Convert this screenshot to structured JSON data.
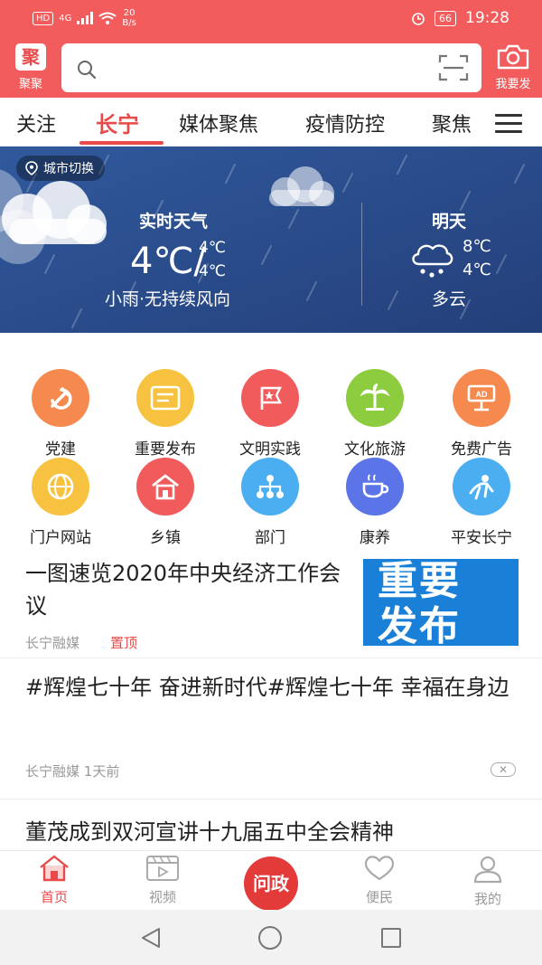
{
  "status_bar": {
    "hd": "HD",
    "network": "4G",
    "speed_value": "20",
    "speed_unit": "B/s",
    "battery": "66",
    "time": "19:28"
  },
  "header": {
    "logo_label": "聚聚",
    "search_placeholder": "",
    "camera_label": "我要发"
  },
  "tabs": [
    {
      "label": "关注"
    },
    {
      "label": "长宁"
    },
    {
      "label": "媒体聚焦"
    },
    {
      "label": "疫情防控"
    },
    {
      "label": "聚焦"
    }
  ],
  "weather": {
    "city_switch": "城市切换",
    "now_title": "实时天气",
    "now_temp": "4℃/",
    "now_high": "4℃",
    "now_low": "4℃",
    "now_desc": "小雨·无持续风向",
    "tomorrow_title": "明天",
    "tomorrow_high": "8℃",
    "tomorrow_low": "4℃",
    "tomorrow_desc": "多云"
  },
  "shortcuts": [
    {
      "label": "党建",
      "color": "#f5894e",
      "icon": "party-emblem-icon"
    },
    {
      "label": "重要发布",
      "color": "#f7c23f",
      "icon": "announcement-icon"
    },
    {
      "label": "文明实践",
      "color": "#f25b5b",
      "icon": "flag-star-icon"
    },
    {
      "label": "文化旅游",
      "color": "#8ccc3e",
      "icon": "palm-tree-icon"
    },
    {
      "label": "免费广告",
      "color": "#f5894e",
      "icon": "ad-board-icon"
    },
    {
      "label": "门户网站",
      "color": "#f7c23f",
      "icon": "globe-icon"
    },
    {
      "label": "乡镇",
      "color": "#f25b5b",
      "icon": "house-icon"
    },
    {
      "label": "部门",
      "color": "#4aaef0",
      "icon": "org-chart-icon"
    },
    {
      "label": "康养",
      "color": "#5b74e8",
      "icon": "tea-cup-icon"
    },
    {
      "label": "平安长宁",
      "color": "#4aaef0",
      "icon": "shield-person-icon"
    }
  ],
  "news": [
    {
      "title": "一图速览2020年中央经济工作会议",
      "source": "长宁融媒",
      "tag": "置顶",
      "thumb_text_1": "重要",
      "thumb_text_2": "发布"
    },
    {
      "title": "#辉煌七十年 奋进新时代#辉煌七十年 幸福在身边",
      "source": "长宁融媒",
      "time": "1天前",
      "close": "✕"
    },
    {
      "title": "董茂成到双河宣讲十九届五中全会精神"
    }
  ],
  "bottom_nav": {
    "home": "首页",
    "video": "视频",
    "center": "问政",
    "service": "便民",
    "mine": "我的"
  }
}
